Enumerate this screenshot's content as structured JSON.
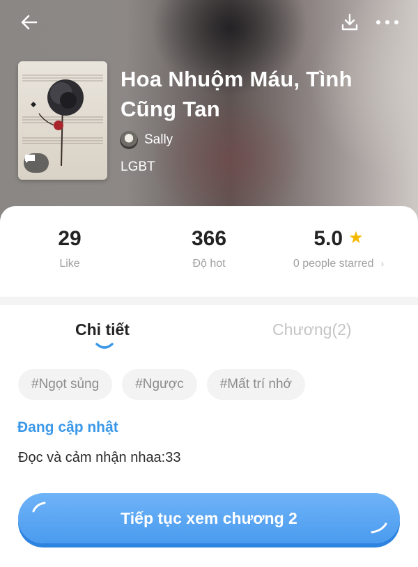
{
  "header": {
    "back_icon": "arrow-left-icon",
    "download_icon": "download-icon",
    "more_icon": "more-horizontal-icon"
  },
  "story": {
    "title": "Hoa Nhuộm Máu, Tình Cũng Tan",
    "author": "Sally",
    "genre": "LGBT"
  },
  "stats": {
    "likes": {
      "value": "29",
      "label": "Like"
    },
    "hot": {
      "value": "366",
      "label": "Độ hot"
    },
    "rating": {
      "value": "5.0",
      "label": "0 people starred"
    }
  },
  "tabs": [
    {
      "label": "Chi tiết",
      "active": true
    },
    {
      "label": "Chương(2)",
      "active": false
    }
  ],
  "tags": [
    "#Ngọt sủng",
    "#Ngược",
    "#Mất trí nhớ"
  ],
  "status": "Đang cập nhật",
  "description": "Đọc và cảm nhận nhaa:33",
  "cta": {
    "label": "Tiếp tục xem chương 2"
  },
  "colors": {
    "accent": "#4a9bef",
    "status": "#3b98e8",
    "star": "#f5b800"
  }
}
